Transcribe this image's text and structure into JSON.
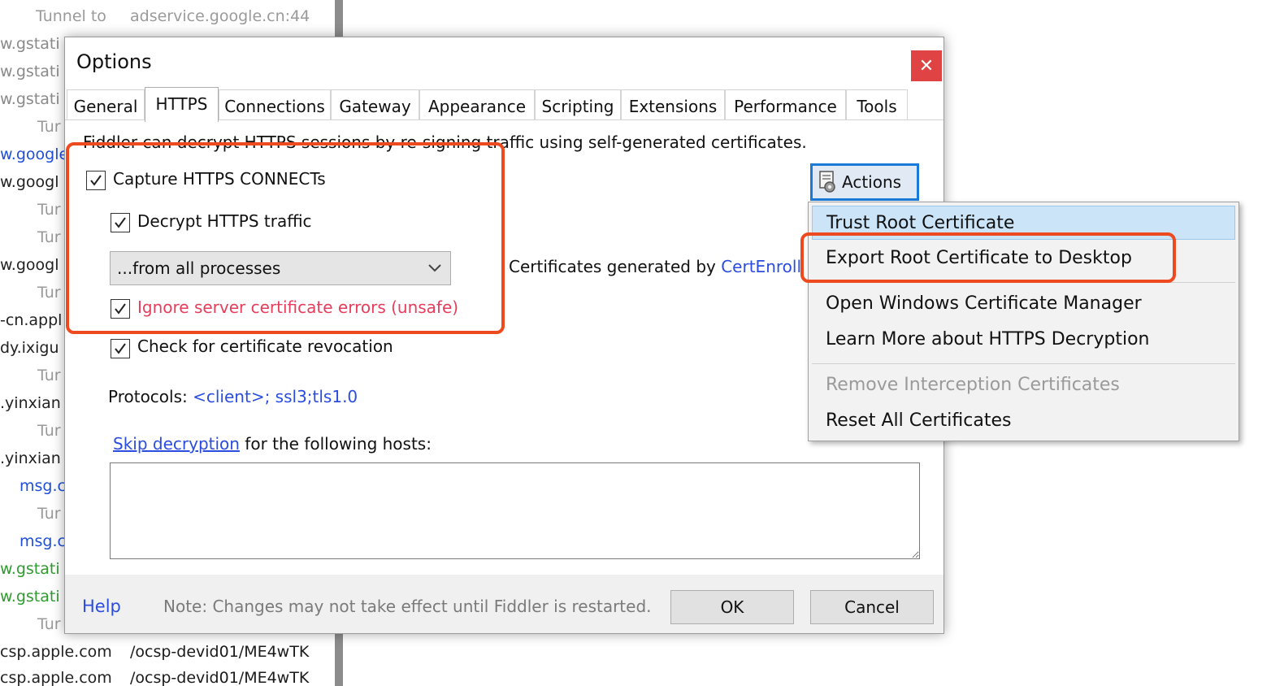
{
  "background_list": {
    "rows": [
      {
        "col1": "Tunnel to",
        "col2": "adservice.google.cn:44",
        "style": "tunnel"
      },
      {
        "col1": "w.gstati",
        "col2": "",
        "style": "gray"
      },
      {
        "col1": "w.gstati",
        "col2": "",
        "style": "gray"
      },
      {
        "col1": "w.gstati",
        "col2": "",
        "style": "gray"
      },
      {
        "col1": "Tur",
        "col2": "",
        "style": "tunnel"
      },
      {
        "col1": "w.google",
        "col2": "",
        "style": "blue"
      },
      {
        "col1": "w.googl",
        "col2": "",
        "style": "black"
      },
      {
        "col1": "Tur",
        "col2": "",
        "style": "tunnel"
      },
      {
        "col1": "Tur",
        "col2": "",
        "style": "tunnel"
      },
      {
        "col1": "w.googl",
        "col2": "",
        "style": "black"
      },
      {
        "col1": "Tur",
        "col2": "",
        "style": "tunnel"
      },
      {
        "col1": "-cn.appl",
        "col2": "",
        "style": "black"
      },
      {
        "col1": "dy.ixigu",
        "col2": "",
        "style": "black"
      },
      {
        "col1": "Tur",
        "col2": "",
        "style": "tunnel"
      },
      {
        "col1": ".yinxian",
        "col2": "",
        "style": "black"
      },
      {
        "col1": "Tur",
        "col2": "",
        "style": "tunnel"
      },
      {
        "col1": ".yinxian",
        "col2": "",
        "style": "black"
      },
      {
        "col1": "msg.c",
        "col2": "",
        "style": "blue"
      },
      {
        "col1": "Tur",
        "col2": "",
        "style": "tunnel"
      },
      {
        "col1": "msg.c",
        "col2": "",
        "style": "blue"
      },
      {
        "col1": "w.gstati",
        "col2": "",
        "style": "green"
      },
      {
        "col1": "w.gstati",
        "col2": "",
        "style": "green"
      },
      {
        "col1": "Tur",
        "col2": "",
        "style": "tunnel"
      },
      {
        "col1": "csp.apple.com",
        "col2": "/ocsp-devid01/ME4wTK",
        "style": "black"
      },
      {
        "col1": "csp.apple.com",
        "col2": "/ocsp-devid01/ME4wTK",
        "style": "black"
      }
    ]
  },
  "dialog": {
    "title": "Options",
    "close_glyph": "✕",
    "tabs": [
      {
        "label": "General"
      },
      {
        "label": "HTTPS"
      },
      {
        "label": "Connections"
      },
      {
        "label": "Gateway"
      },
      {
        "label": "Appearance"
      },
      {
        "label": "Scripting"
      },
      {
        "label": "Extensions"
      },
      {
        "label": "Performance"
      },
      {
        "label": "Tools"
      }
    ],
    "active_tab": "HTTPS",
    "intro": "Fiddler can decrypt HTTPS sessions by re-signing traffic using self-generated certificates.",
    "capture_connects": {
      "label": "Capture HTTPS CONNECTs",
      "checked": true
    },
    "decrypt_traffic": {
      "label": "Decrypt HTTPS traffic",
      "checked": true
    },
    "process_filter": {
      "selected": "...from all processes"
    },
    "ignore_errors": {
      "label": "Ignore server certificate errors (unsafe)",
      "checked": true
    },
    "check_revocation": {
      "label": "Check for certificate revocation",
      "checked": true
    },
    "certs_generated_prefix": "Certificates generated by ",
    "certs_generated_link": "CertEnroll",
    "actions_label": "Actions",
    "protocols_label": "Protocols: ",
    "protocols_value": "<client>; ssl3;tls1.0",
    "skip_link": "Skip decryption",
    "skip_suffix": " for the following hosts:",
    "skip_hosts_value": "",
    "help_label": "Help",
    "note": "Note: Changes may not take effect until Fiddler is restarted.",
    "ok_label": "OK",
    "cancel_label": "Cancel"
  },
  "actions_menu": {
    "items": [
      {
        "label": "Trust Root Certificate",
        "state": "hover"
      },
      {
        "label": "Export Root Certificate to Desktop",
        "state": "normal"
      },
      {
        "label": "Open Windows Certificate Manager",
        "state": "normal"
      },
      {
        "label": "Learn More about HTTPS Decryption",
        "state": "normal"
      },
      {
        "label": "Remove Interception Certificates",
        "state": "disabled"
      },
      {
        "label": "Reset All Certificates",
        "state": "normal"
      }
    ]
  },
  "colors": {
    "link": "#2a4de0",
    "warning_text": "#e63e5c",
    "highlight_frame": "#ee4a1f",
    "close_button": "#e04343",
    "menu_hover": "#cce4f7"
  }
}
